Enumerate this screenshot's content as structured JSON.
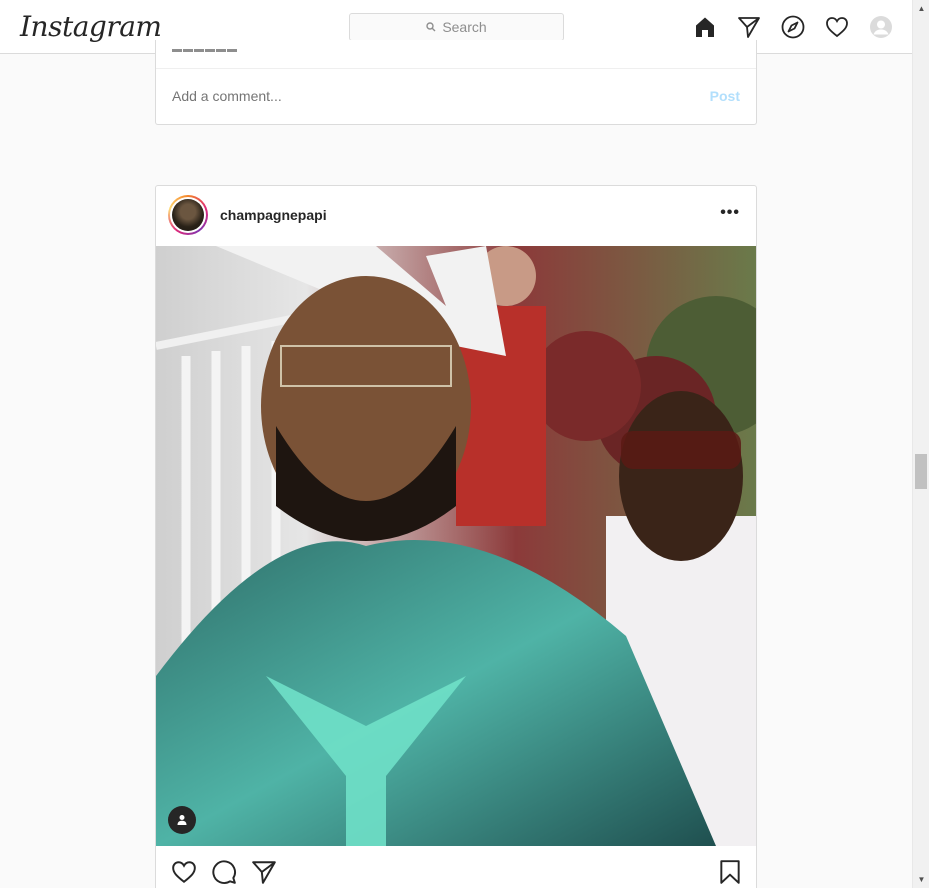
{
  "app": {
    "logo_text": "Instagram"
  },
  "header": {
    "search_placeholder": "Search",
    "icons": [
      "home-icon",
      "direct-icon",
      "explore-icon",
      "activity-heart-icon",
      "profile-avatar-icon"
    ]
  },
  "previous_post": {
    "comment_placeholder": "Add a comment...",
    "post_label": "Post"
  },
  "post": {
    "username": "champagnepapi",
    "more_label": "•••",
    "media_description_icon": "tagged-people-icon"
  },
  "colors": {
    "border": "#dbdbdb",
    "post_button_disabled": "#b2dffc",
    "text": "#262626",
    "muted": "#8e8e8e"
  }
}
